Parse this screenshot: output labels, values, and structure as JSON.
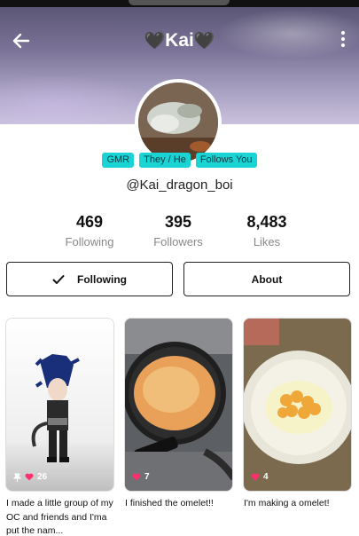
{
  "header": {
    "title": "Kai",
    "heart_glyph": "🖤"
  },
  "profile": {
    "badges": [
      "GMR",
      "They / He",
      "Follows You"
    ],
    "handle": "@Kai_dragon_boi"
  },
  "stats": [
    {
      "value": "469",
      "label": "Following"
    },
    {
      "value": "395",
      "label": "Followers"
    },
    {
      "value": "8,483",
      "label": "Likes"
    }
  ],
  "actions": {
    "following_label": "Following",
    "about_label": "About"
  },
  "posts": [
    {
      "likes": "26",
      "pinned": true,
      "caption": "I made a little group of my OC and friends and I'ma put the nam..."
    },
    {
      "likes": "7",
      "pinned": false,
      "caption": "I finished the omelet!!"
    },
    {
      "likes": "4",
      "pinned": false,
      "caption": "I'm making a omelet!"
    }
  ],
  "colors": {
    "badge": "#19d3d4",
    "like_heart": "#ff2f6e"
  }
}
